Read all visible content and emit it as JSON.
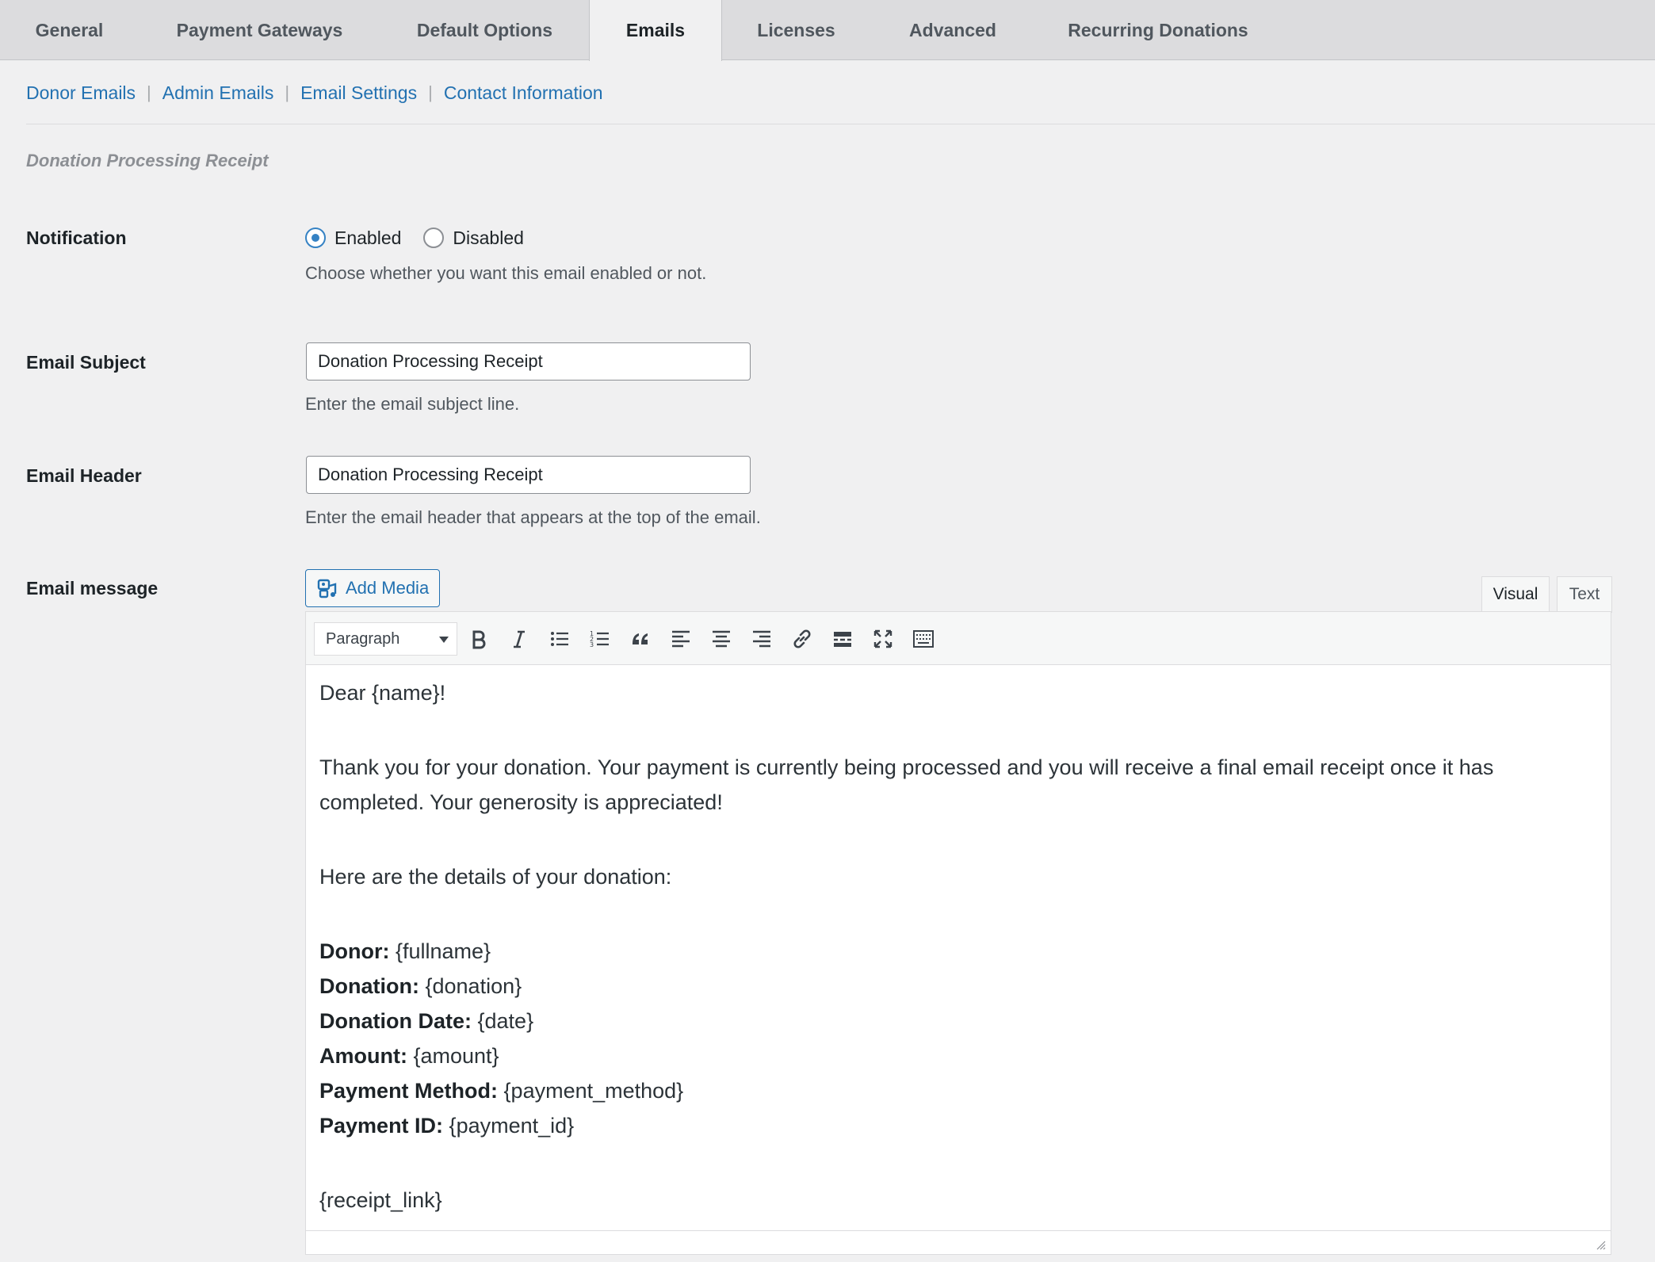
{
  "tabs": [
    {
      "label": "General"
    },
    {
      "label": "Payment Gateways"
    },
    {
      "label": "Default Options"
    },
    {
      "label": "Emails"
    },
    {
      "label": "Licenses"
    },
    {
      "label": "Advanced"
    },
    {
      "label": "Recurring Donations"
    }
  ],
  "active_tab": "Emails",
  "subnav": [
    {
      "label": "Donor Emails"
    },
    {
      "label": "Admin Emails"
    },
    {
      "label": "Email Settings"
    },
    {
      "label": "Contact Information"
    }
  ],
  "section_title": "Donation Processing Receipt",
  "notification": {
    "label": "Notification",
    "options": [
      "Enabled",
      "Disabled"
    ],
    "selected": "Enabled",
    "description": "Choose whether you want this email enabled or not."
  },
  "email_subject": {
    "label": "Email Subject",
    "value": "Donation Processing Receipt",
    "description": "Enter the email subject line."
  },
  "email_header": {
    "label": "Email Header",
    "value": "Donation Processing Receipt",
    "description": "Enter the email header that appears at the top of the email."
  },
  "email_message": {
    "label": "Email message",
    "add_media_label": "Add Media",
    "editor_tabs": [
      "Visual",
      "Text"
    ],
    "active_editor_tab": "Visual",
    "format_select": "Paragraph",
    "toolbar_icons": [
      "bold-icon",
      "italic-icon",
      "bulleted-list-icon",
      "numbered-list-icon",
      "blockquote-icon",
      "align-left-icon",
      "align-center-icon",
      "align-right-icon",
      "link-icon",
      "read-more-icon",
      "fullscreen-icon",
      "toolbar-toggle-icon"
    ],
    "greeting": "Dear {name}!",
    "paragraph": "Thank you for your donation. Your payment is currently being processed and you will receive a final email receipt once it has completed. Your generosity is appreciated!",
    "details_intro": "Here are the details of your donation:",
    "details": [
      {
        "label": "Donor:",
        "value": " {fullname}"
      },
      {
        "label": "Donation:",
        "value": " {donation}"
      },
      {
        "label": "Donation Date:",
        "value": " {date}"
      },
      {
        "label": "Amount:",
        "value": " {amount}"
      },
      {
        "label": "Payment Method:",
        "value": " {payment_method}"
      },
      {
        "label": "Payment ID:",
        "value": " {payment_id}"
      }
    ],
    "receipt_link": "{receipt_link}"
  },
  "colors": {
    "link": "#2271b1",
    "radio_accent": "#3582c4",
    "page_bg": "#f0f0f1"
  }
}
